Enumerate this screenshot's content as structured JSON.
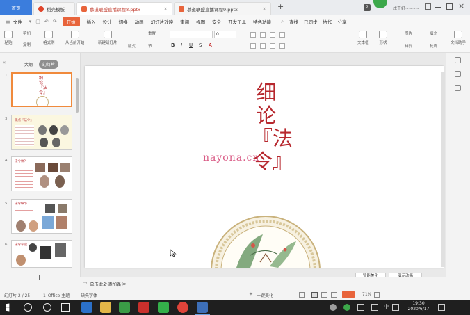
{
  "tabs": {
    "home": "首页",
    "t1": "稻壳模板",
    "t2": "慕道联盟直播课程8.pptx",
    "t3": "慕道联盟直播课程9.pptx",
    "add": "+",
    "badge": "2",
    "user": "戊平好~~~~"
  },
  "menu": {
    "file": "文件",
    "items": [
      "开始",
      "插入",
      "设计",
      "切换",
      "动画",
      "幻灯片放映",
      "审阅",
      "视图",
      "安全",
      "开发工具",
      "特色功能"
    ],
    "search": "查找",
    "sync": "已同步",
    "collab": "协作",
    "share": "分享"
  },
  "toolbar": {
    "paste": "粘贴",
    "cut": "剪切",
    "copy": "复制",
    "format": "格式刷",
    "from_start": "从当前开始",
    "new_slide": "新建幻灯片",
    "layout": "版式",
    "section": "节",
    "reset": "重置",
    "font_size": "0",
    "textbox": "文本框",
    "shape": "形状",
    "arrange": "排列",
    "picture": "图片",
    "fill": "填充",
    "outline": "轮廓",
    "doc_assist": "文档助手"
  },
  "left_panel": {
    "tab_outline": "大纲",
    "tab_slides": "幻灯片",
    "thumb_numbers": [
      "1",
      "3",
      "4",
      "5",
      "6"
    ],
    "thumb1_text": "细论『法令』",
    "thumb3_text": "观点『法令』",
    "thumb4_text": "法令纹？",
    "thumb5_text": "法令细节",
    "thumb6_text": "法令学说",
    "add": "+"
  },
  "slide": {
    "title": "细论『法令』",
    "watermark": "nayona.cn",
    "remark_btn": "智能美化",
    "effect_btn": "演示动画"
  },
  "notes": {
    "placeholder": "单击此处添加备注"
  },
  "status": {
    "slide_info": "幻灯片 2 / 25",
    "theme": "1_Office 主题",
    "missing_font": "缺失字体",
    "beautify": "一键美化",
    "zoom": "71%"
  },
  "taskbar": {
    "time": "19:30",
    "date": "2020/6/17",
    "lang": "中"
  },
  "colors": {
    "accent": "#e8643b",
    "home_tab": "#3b7ddd",
    "title_red": "#b7282e",
    "watermark": "#d23c6e",
    "selection": "#f08a3c"
  }
}
